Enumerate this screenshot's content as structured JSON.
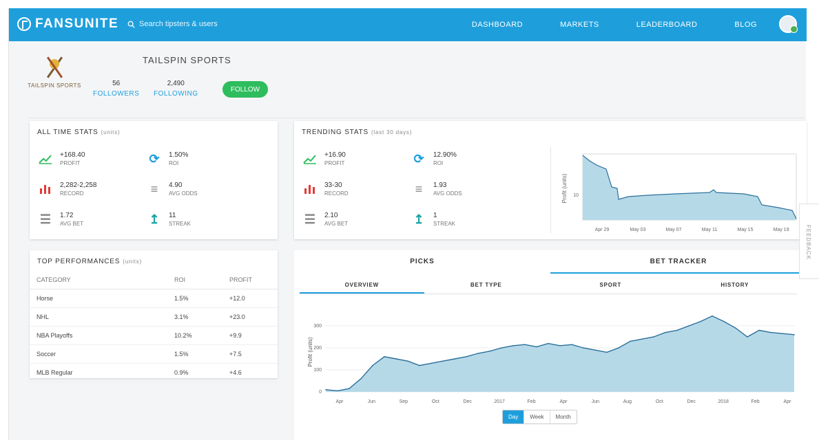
{
  "app": {
    "brand": "FANSUNITE",
    "search_placeholder": "Search tipsters & users",
    "nav": [
      "DASHBOARD",
      "MARKETS",
      "LEADERBOARD",
      "BLOG"
    ],
    "accent_color": "#1e9fdc"
  },
  "profile": {
    "logo_text": "TAILSPIN SPORTS",
    "name": "TAILSPIN SPORTS",
    "followers_count": "56",
    "followers_label": "FOLLOWERS",
    "following_count": "2,490",
    "following_label": "FOLLOWING",
    "follow_button": "FOLLOW"
  },
  "all_time_stats": {
    "title": "ALL TIME STATS",
    "sub": "(units)",
    "items": [
      {
        "icon": "trend-up-icon",
        "value": "+168.40",
        "label": "PROFIT"
      },
      {
        "icon": "refresh-icon",
        "value": "1.50%",
        "label": "ROI"
      },
      {
        "icon": "bar-chart-icon",
        "value": "2,282-2,258",
        "label": "RECORD"
      },
      {
        "icon": "list-icon",
        "value": "4.90",
        "label": "AVG ODDS"
      },
      {
        "icon": "stack-icon",
        "value": "1.72",
        "label": "AVG BET"
      },
      {
        "icon": "streak-icon",
        "value": "11",
        "label": "STREAK"
      }
    ]
  },
  "trending_stats": {
    "title": "TRENDING STATS",
    "sub": "(last 30 days)",
    "items": [
      {
        "icon": "trend-up-icon",
        "value": "+16.90",
        "label": "PROFIT"
      },
      {
        "icon": "refresh-icon",
        "value": "12.90%",
        "label": "ROI"
      },
      {
        "icon": "bar-chart-icon",
        "value": "33-30",
        "label": "RECORD"
      },
      {
        "icon": "list-icon",
        "value": "1.93",
        "label": "AVG ODDS"
      },
      {
        "icon": "stack-icon",
        "value": "2.10",
        "label": "AVG BET"
      },
      {
        "icon": "streak-icon",
        "value": "1",
        "label": "STREAK"
      }
    ],
    "mini_chart": {
      "ylabel": "Profit (units)",
      "ytick": "10",
      "xticks": [
        "Apr 29",
        "May 03",
        "May 07",
        "May 11",
        "May 15",
        "May 19"
      ]
    }
  },
  "top_performances": {
    "title": "TOP PERFORMANCES",
    "sub": "(units)",
    "columns": [
      "CATEGORY",
      "ROI",
      "PROFIT"
    ],
    "rows": [
      [
        "Horse",
        "1.5%",
        "+12.0"
      ],
      [
        "NHL",
        "3.1%",
        "+23.0"
      ],
      [
        "NBA Playoffs",
        "10.2%",
        "+9.9"
      ],
      [
        "Soccer",
        "1.5%",
        "+7.5"
      ],
      [
        "MLB Regular",
        "0.9%",
        "+4.6"
      ]
    ]
  },
  "picks_panel": {
    "tabs": [
      "PICKS",
      "BET TRACKER"
    ],
    "active_tab": 1,
    "subtabs": [
      "OVERVIEW",
      "BET TYPE",
      "SPORT",
      "HISTORY"
    ],
    "active_subtab": 0,
    "range_buttons": [
      "Day",
      "Week",
      "Month"
    ],
    "active_range": 0
  },
  "chart_data": {
    "type": "area",
    "title": "",
    "xlabel": "",
    "ylabel": "Profit (units)",
    "ylim": [
      0,
      400
    ],
    "yticks": [
      "0",
      "100",
      "200",
      "300"
    ],
    "xticks": [
      "Apr",
      "Jun",
      "Sep",
      "Oct",
      "Dec",
      "2017",
      "Feb",
      "Apr",
      "Jun",
      "Aug",
      "Oct",
      "Dec",
      "2018",
      "Feb",
      "Apr"
    ],
    "x": [
      0,
      1,
      2,
      3,
      4,
      5,
      6,
      7,
      8,
      9,
      10,
      11,
      12,
      13,
      14,
      15,
      16,
      17,
      18,
      19,
      20,
      21,
      22,
      23,
      24,
      25,
      26,
      27,
      28,
      29,
      30,
      31,
      32,
      33,
      34,
      35,
      36,
      37,
      38,
      39,
      40
    ],
    "values": [
      10,
      5,
      15,
      60,
      120,
      160,
      150,
      140,
      120,
      130,
      140,
      150,
      160,
      175,
      185,
      200,
      210,
      215,
      205,
      220,
      210,
      215,
      200,
      190,
      180,
      200,
      230,
      240,
      250,
      270,
      280,
      300,
      320,
      345,
      320,
      290,
      250,
      280,
      270,
      265,
      260
    ],
    "fill_color": "#b6d9e8",
    "line_color": "#2a6f99"
  }
}
